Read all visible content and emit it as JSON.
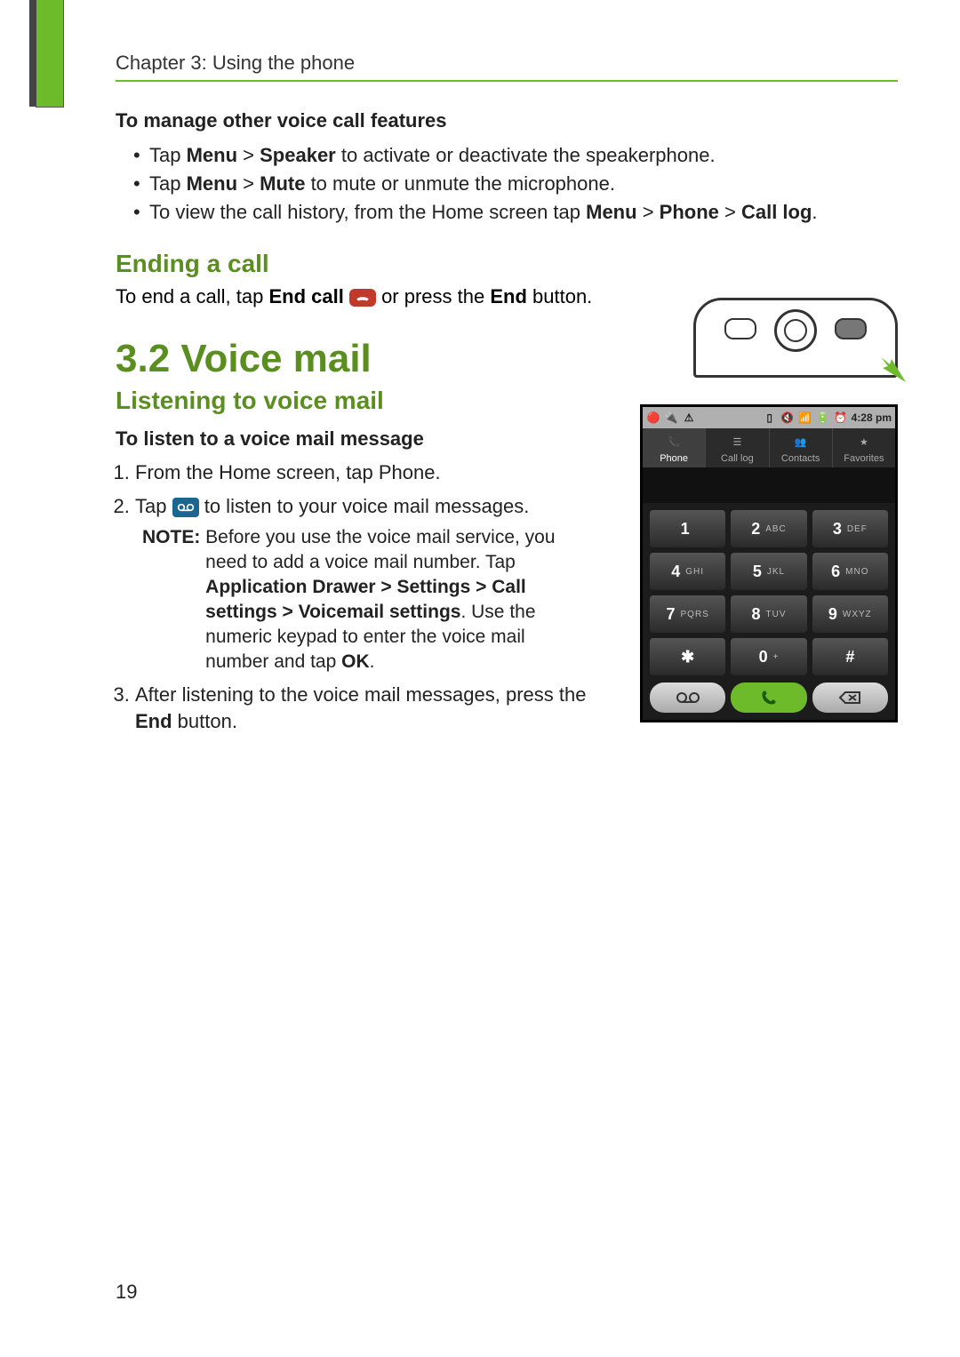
{
  "chapter_header": "Chapter 3: Using the phone",
  "section_manage": {
    "heading": "To manage other voice call features",
    "bullets": {
      "b1": {
        "pre": "Tap ",
        "menu": "Menu",
        "gt": " > ",
        "speaker": "Speaker",
        "post": " to activate or deactivate the speakerphone."
      },
      "b2": {
        "pre": "Tap ",
        "menu": "Menu",
        "gt": " > ",
        "mute": "Mute",
        "post": " to mute or unmute the microphone."
      },
      "b3": {
        "pre": "To view the call history, from the Home screen tap ",
        "menu": "Menu",
        "gt1": " > ",
        "phone": "Phone",
        "gt2": " > ",
        "calllog": "Call log",
        "post": "."
      }
    }
  },
  "section_ending": {
    "heading": "Ending a call",
    "text_pre": "To end a call, tap ",
    "endcall_label": "End call",
    "text_mid": " or press the ",
    "end_label": "End",
    "text_post": " button."
  },
  "section_voicemail": {
    "heading": "3.2 Voice mail",
    "subheading": "Listening to voice mail",
    "instruction": "To listen to a voice mail message",
    "steps": {
      "s1": "From the Home screen, tap Phone.",
      "s2_pre": "Tap ",
      "s2_post": " to listen to your voice mail messages.",
      "note_label": "NOTE:",
      "note_l1": " Before you use the voice mail service, you need to add a voice mail number. Tap ",
      "note_path": "Application Drawer > Settings > Call settings > Voicemail settings",
      "note_l2": ". Use the numeric keypad to enter the voice mail number and tap ",
      "note_ok": "OK",
      "note_l3": ".",
      "s3_pre": "After listening to the voice mail messages, press the ",
      "s3_end": "End",
      "s3_post": " button."
    }
  },
  "phone_ui": {
    "time": "4:28 pm",
    "tabs": {
      "phone": "Phone",
      "calllog": "Call log",
      "contacts": "Contacts",
      "favorites": "Favorites"
    },
    "keys": {
      "k1n": "1",
      "k1l": "",
      "k2n": "2",
      "k2l": "ABC",
      "k3n": "3",
      "k3l": "DEF",
      "k4n": "4",
      "k4l": "GHI",
      "k5n": "5",
      "k5l": "JKL",
      "k6n": "6",
      "k6l": "MNO",
      "k7n": "7",
      "k7l": "PQRS",
      "k8n": "8",
      "k8l": "TUV",
      "k9n": "9",
      "k9l": "WXYZ",
      "kstar": "✱",
      "k0n": "0",
      "k0l": "+",
      "khash": "#"
    }
  },
  "page_number": "19"
}
